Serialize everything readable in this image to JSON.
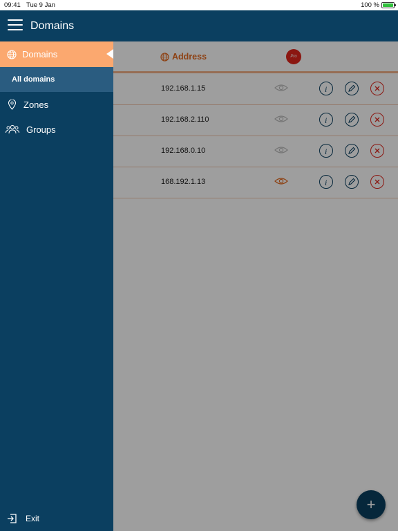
{
  "status_bar": {
    "time": "09:41",
    "date": "Tue 9 Jan",
    "battery": "100 %"
  },
  "header": {
    "title": "Domains"
  },
  "table": {
    "address_header": "Address",
    "pro_badge": "Pro",
    "rows": [
      {
        "address": "192.168.1.15"
      },
      {
        "address": "192.168.2.110"
      },
      {
        "address": "192.168.0.10"
      },
      {
        "address": "168.192.1.13"
      }
    ]
  },
  "fab": {
    "label": "+"
  },
  "drawer": {
    "domains": "Domains",
    "all_domains": "All domains",
    "zones": "Zones",
    "groups": "Groups",
    "exit": "Exit"
  },
  "colors": {
    "primary": "#0b3f60",
    "accent": "#fba86f",
    "accent_dark": "#e4691f",
    "danger": "#e0261c"
  }
}
